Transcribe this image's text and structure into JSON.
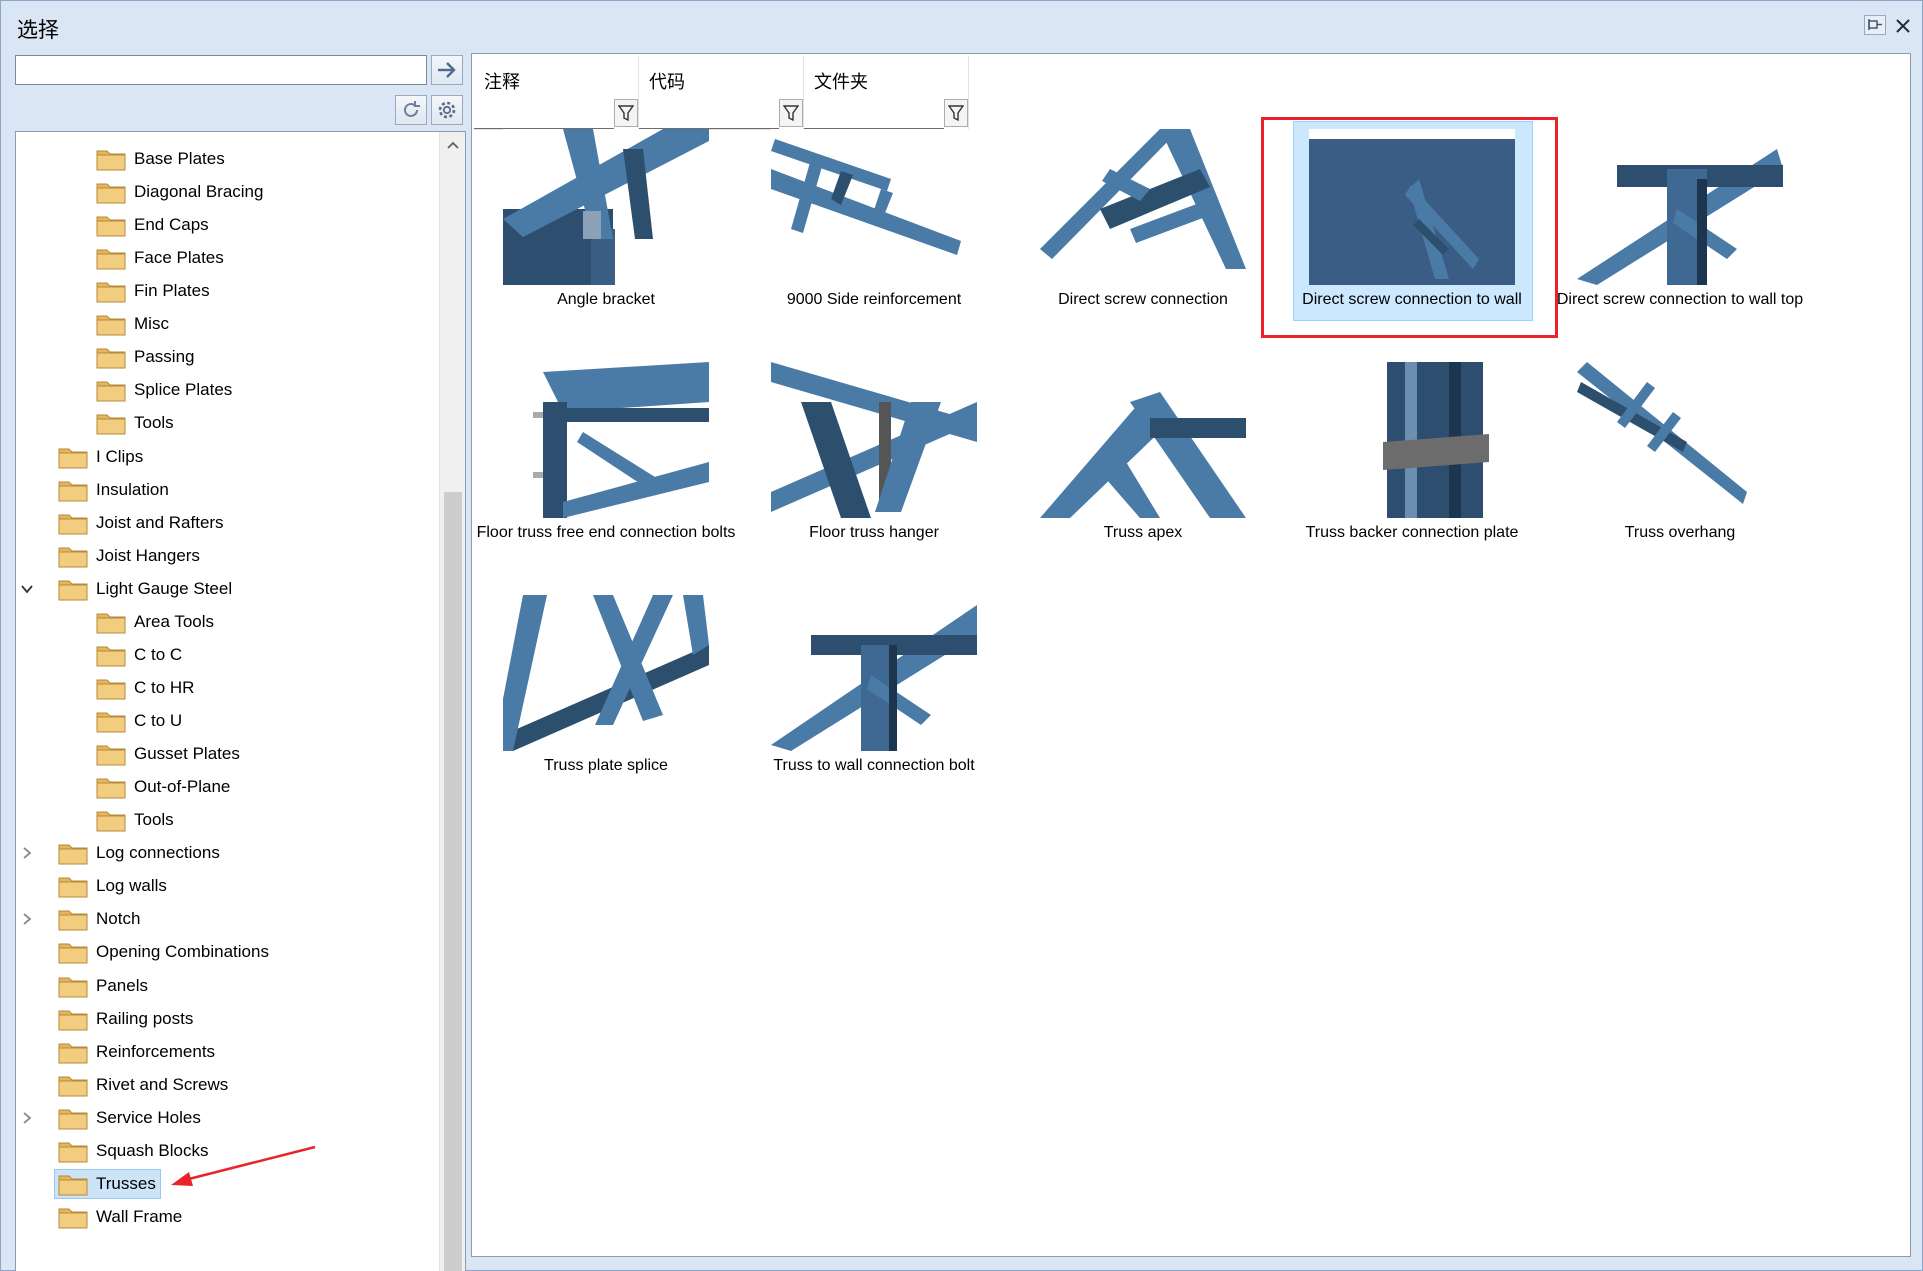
{
  "window": {
    "title": "选择"
  },
  "search": {
    "value": "",
    "placeholder": ""
  },
  "tree": {
    "items": [
      {
        "label": "Base Plates",
        "level": 2
      },
      {
        "label": "Diagonal Bracing",
        "level": 2
      },
      {
        "label": "End Caps",
        "level": 2
      },
      {
        "label": "Face Plates",
        "level": 2
      },
      {
        "label": "Fin Plates",
        "level": 2
      },
      {
        "label": "Misc",
        "level": 2
      },
      {
        "label": "Passing",
        "level": 2
      },
      {
        "label": "Splice Plates",
        "level": 2
      },
      {
        "label": "Tools",
        "level": 2
      },
      {
        "label": "I Clips",
        "level": 1
      },
      {
        "label": "Insulation",
        "level": 1
      },
      {
        "label": "Joist and Rafters",
        "level": 1
      },
      {
        "label": "Joist Hangers",
        "level": 1
      },
      {
        "label": "Light Gauge Steel",
        "level": 1,
        "expanded": true
      },
      {
        "label": "Area Tools",
        "level": 2
      },
      {
        "label": "C to C",
        "level": 2
      },
      {
        "label": "C to HR",
        "level": 2
      },
      {
        "label": "C to U",
        "level": 2
      },
      {
        "label": "Gusset Plates",
        "level": 2
      },
      {
        "label": "Out-of-Plane",
        "level": 2
      },
      {
        "label": "Tools",
        "level": 2
      },
      {
        "label": "Log connections",
        "level": 1,
        "collapsed": true
      },
      {
        "label": "Log walls",
        "level": 1
      },
      {
        "label": "Notch",
        "level": 1,
        "collapsed": true
      },
      {
        "label": "Opening Combinations",
        "level": 1
      },
      {
        "label": "Panels",
        "level": 1
      },
      {
        "label": "Railing posts",
        "level": 1
      },
      {
        "label": "Reinforcements",
        "level": 1
      },
      {
        "label": "Rivet and Screws",
        "level": 1
      },
      {
        "label": "Service Holes",
        "level": 1,
        "collapsed": true
      },
      {
        "label": "Squash Blocks",
        "level": 1
      },
      {
        "label": "Trusses",
        "level": 1,
        "selected": true
      },
      {
        "label": "Wall Frame",
        "level": 1
      }
    ]
  },
  "columns": [
    {
      "title": "注释"
    },
    {
      "title": "代码"
    },
    {
      "title": "文件夹"
    }
  ],
  "tiles": [
    {
      "label": "Angle bracket"
    },
    {
      "label": "9000 Side reinforcement"
    },
    {
      "label": "Direct screw connection"
    },
    {
      "label": "Direct screw connection to wall",
      "selected": true
    },
    {
      "label": "Direct screw connection to wall top"
    },
    {
      "label": "Floor truss free end connection bolts"
    },
    {
      "label": "Floor truss hanger"
    },
    {
      "label": "Truss apex"
    },
    {
      "label": "Truss backer connection plate"
    },
    {
      "label": "Truss overhang"
    },
    {
      "label": "Truss plate splice"
    },
    {
      "label": "Truss to wall connection bolt"
    }
  ],
  "colors": {
    "steel": "#4a7aa6",
    "steel_dark": "#2d4f6e",
    "highlight": "#e8242a",
    "folder": "#f3cd7f"
  }
}
